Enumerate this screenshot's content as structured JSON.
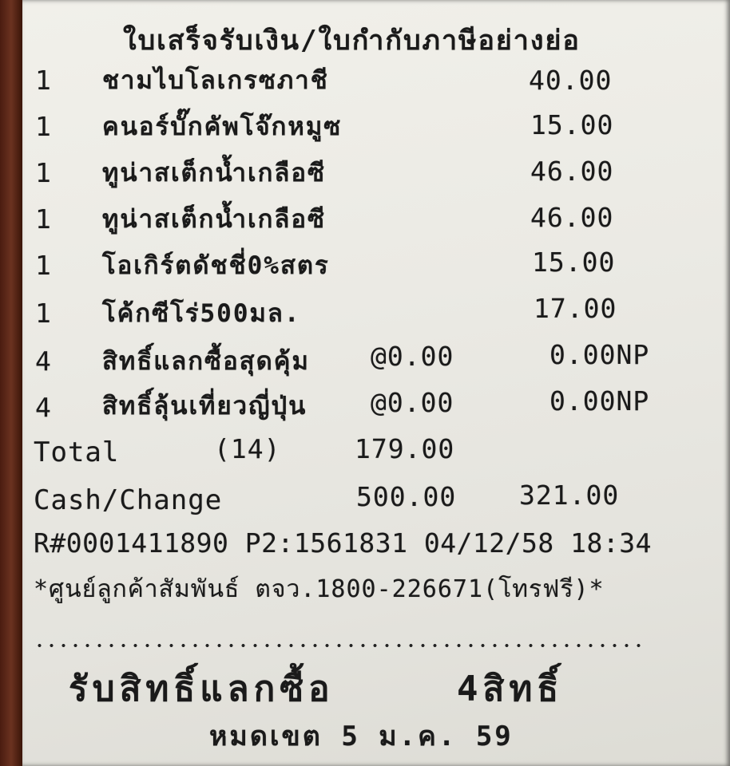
{
  "receipt": {
    "title": "ใบเสร็จรับเงิน/ใบกำกับภาษีอย่างย่อ",
    "items": [
      {
        "qty": "1",
        "name": "ชามไบโลเกรซภาชี",
        "unit_price": "",
        "amount": "40.00"
      },
      {
        "qty": "1",
        "name": "คนอร์บั๊กคัพโจ๊กหมูซ",
        "unit_price": "",
        "amount": "15.00"
      },
      {
        "qty": "1",
        "name": "ทูน่าสเต็กน้ำเกลือซี",
        "unit_price": "",
        "amount": "46.00"
      },
      {
        "qty": "1",
        "name": "ทูน่าสเต็กน้ำเกลือซี",
        "unit_price": "",
        "amount": "46.00"
      },
      {
        "qty": "1",
        "name": "โอเกิร์ตดัชชี่0%สตร",
        "unit_price": "",
        "amount": "15.00"
      },
      {
        "qty": "1",
        "name": "โค้กซีโร่500มล.",
        "unit_price": "",
        "amount": "17.00"
      },
      {
        "qty": "4",
        "name": "สิทธิ์แลกซื้อสุดคุ้ม",
        "unit_price": "@0.00",
        "amount": "0.00NP"
      },
      {
        "qty": "4",
        "name": "สิทธิ์ลุ้นเที่ยวญี่ปุ่น",
        "unit_price": "@0.00",
        "amount": "0.00NP"
      }
    ],
    "total": {
      "label": "Total",
      "count": "(14)",
      "amount": "179.00"
    },
    "cash_change": {
      "label": "Cash/Change",
      "cash": "500.00",
      "change": "321.00"
    },
    "receipt_line": "R#0001411890 P2:1561831 04/12/58 18:34",
    "hotline": "*ศูนย์ลูกค้าสัมพันธ์ ตจว.1800-226671(โทรฟรี)*",
    "promo": {
      "label": "รับสิทธิ์แลกซื้อ",
      "count": "4สิทธิ์"
    },
    "expiry": "หมดเขต 5 ม.ค. 59"
  }
}
